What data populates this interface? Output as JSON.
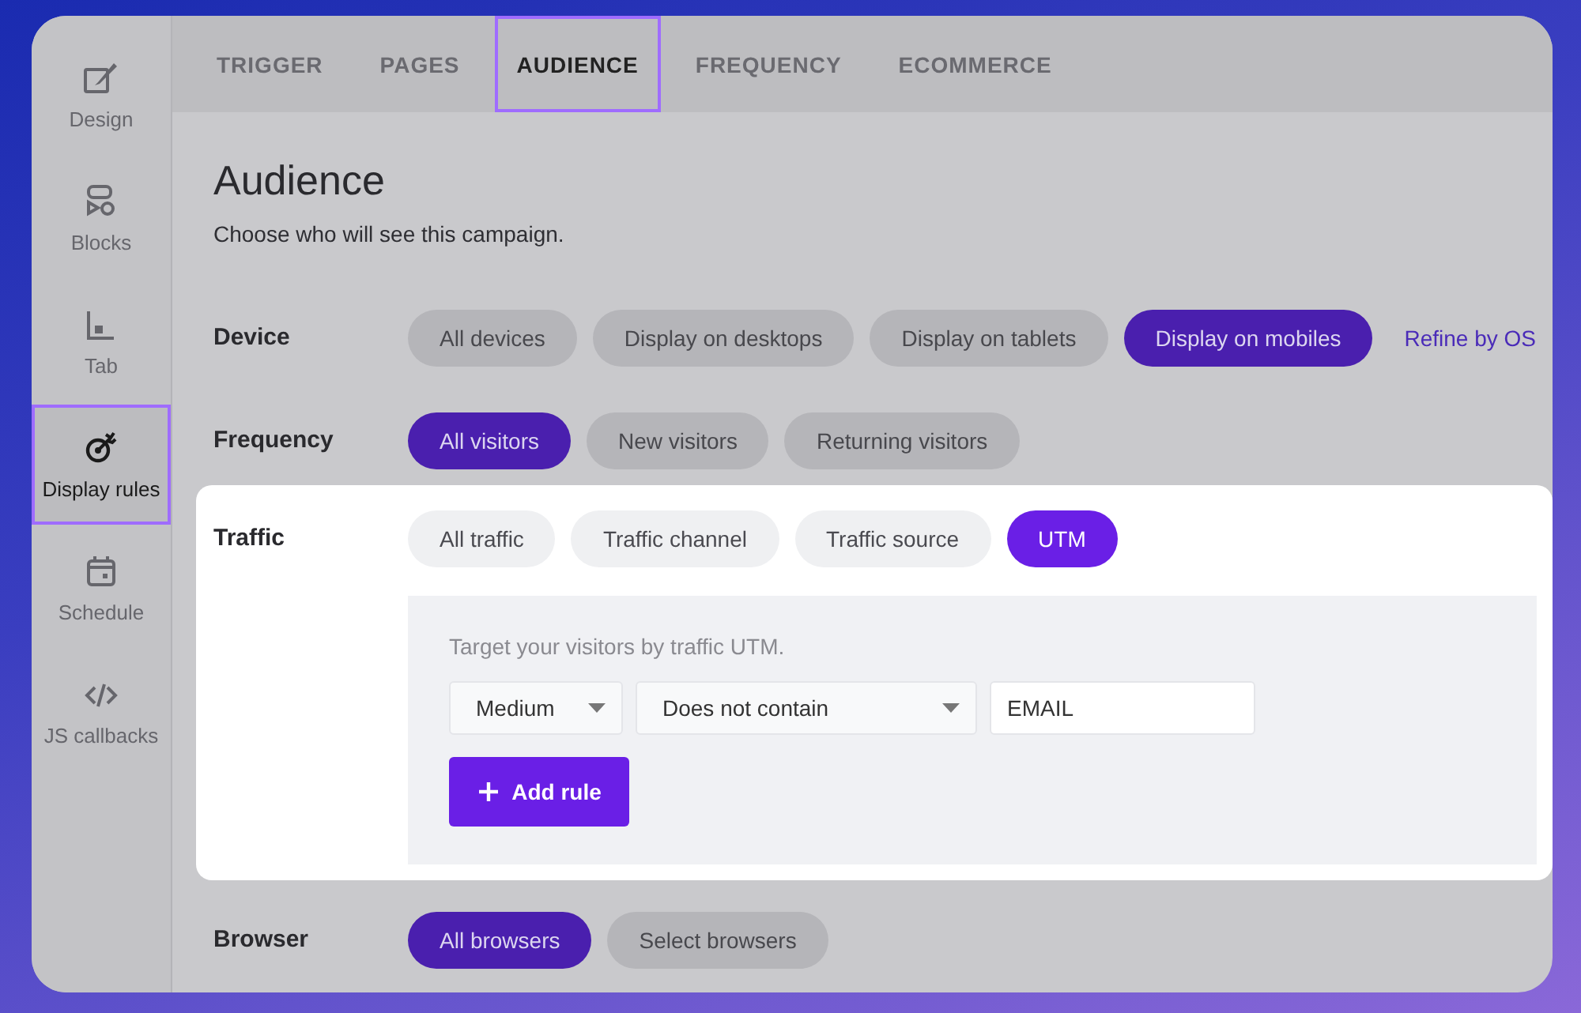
{
  "sidebar": {
    "items": [
      {
        "label": "Design",
        "selected": false
      },
      {
        "label": "Blocks",
        "selected": false
      },
      {
        "label": "Tab",
        "selected": false
      },
      {
        "label": "Display rules",
        "selected": true
      },
      {
        "label": "Schedule",
        "selected": false
      },
      {
        "label": "JS callbacks",
        "selected": false
      }
    ]
  },
  "tabs": [
    {
      "label": "TRIGGER",
      "selected": false
    },
    {
      "label": "PAGES",
      "selected": false
    },
    {
      "label": "AUDIENCE",
      "selected": true
    },
    {
      "label": "FREQUENCY",
      "selected": false
    },
    {
      "label": "ECOMMERCE",
      "selected": false
    }
  ],
  "title": "Audience",
  "subtitle": "Choose who will see this campaign.",
  "sections": [
    {
      "label": "Device",
      "highlighted": false,
      "options": [
        {
          "label": "All devices",
          "selected": false
        },
        {
          "label": "Display on desktops",
          "selected": false
        },
        {
          "label": "Display on tablets",
          "selected": false
        },
        {
          "label": "Display on mobiles",
          "selected": true
        }
      ],
      "link": "Refine by OS"
    },
    {
      "label": "Frequency",
      "highlighted": false,
      "options": [
        {
          "label": "All visitors",
          "selected": true
        },
        {
          "label": "New visitors",
          "selected": false
        },
        {
          "label": "Returning visitors",
          "selected": false
        }
      ]
    },
    {
      "label": "Traffic",
      "highlighted": true,
      "options": [
        {
          "label": "All traffic",
          "selected": false
        },
        {
          "label": "Traffic channel",
          "selected": false
        },
        {
          "label": "Traffic source",
          "selected": false
        },
        {
          "label": "UTM",
          "selected": true
        }
      ],
      "panel": {
        "hint": "Target your visitors by traffic UTM.",
        "parameter": "Medium",
        "operator": "Does not contain",
        "value": "EMAIL",
        "button": "Add rule"
      }
    },
    {
      "label": "Browser",
      "highlighted": false,
      "options": [
        {
          "label": "All browsers",
          "selected": true
        },
        {
          "label": "Select browsers",
          "selected": false
        }
      ]
    }
  ]
}
